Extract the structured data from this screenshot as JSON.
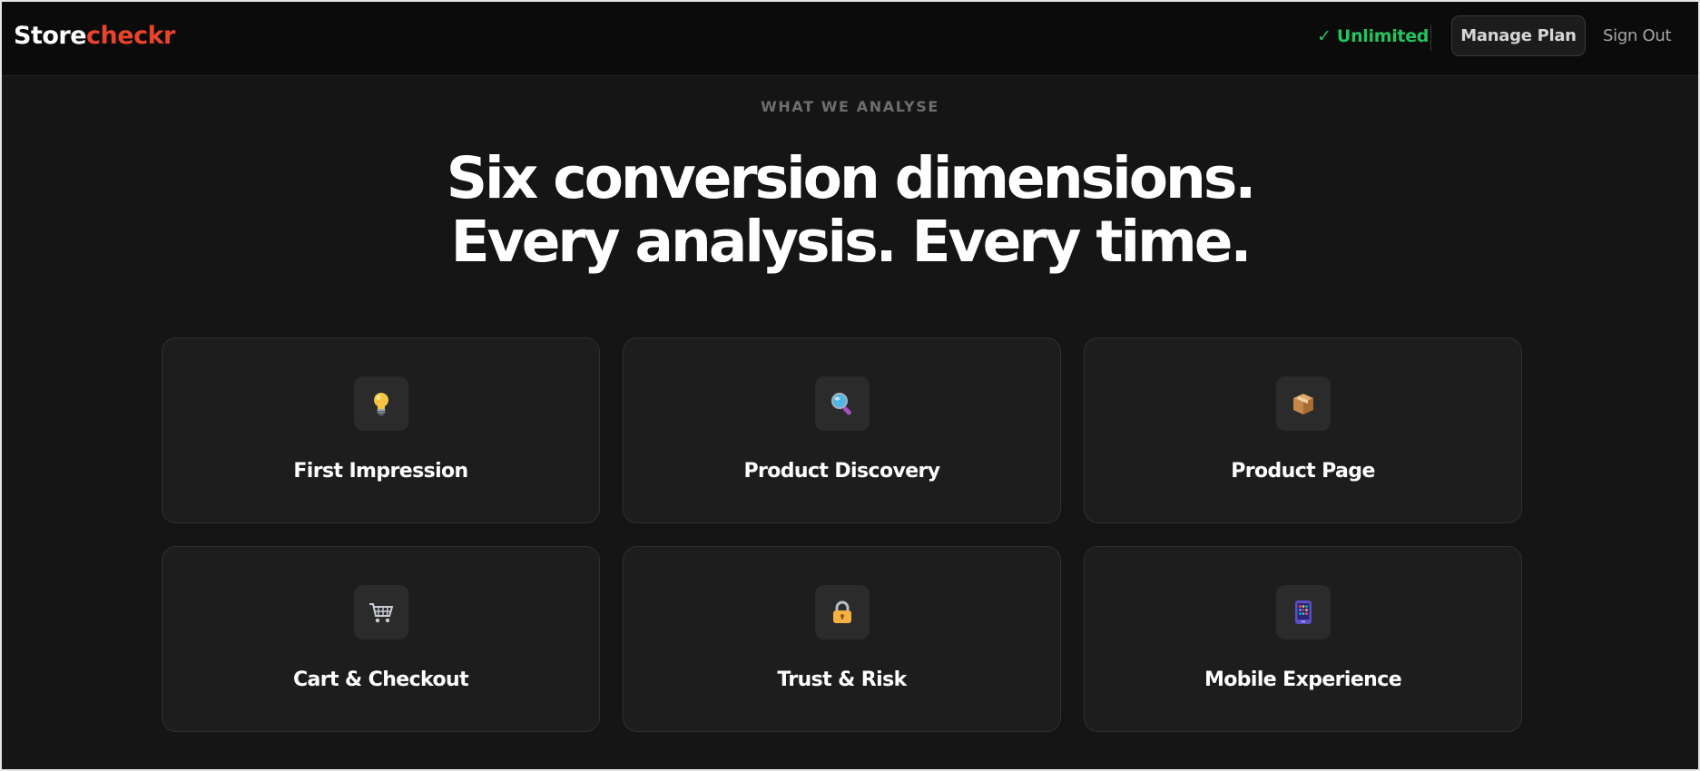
{
  "header": {
    "logo_part1": "Store",
    "logo_part2": "checkr",
    "plan_status": "✓ Unlimited",
    "manage_plan_label": "Manage Plan",
    "sign_out_label": "Sign Out"
  },
  "hero": {
    "eyebrow": "WHAT WE ANALYSE",
    "headline_line1": "Six conversion dimensions.",
    "headline_line2": "Every analysis. Every time."
  },
  "cards": [
    {
      "label": "First Impression",
      "icon": "lightbulb-icon"
    },
    {
      "label": "Product Discovery",
      "icon": "magnifier-icon"
    },
    {
      "label": "Product Page",
      "icon": "package-icon"
    },
    {
      "label": "Cart & Checkout",
      "icon": "shopping-cart-icon"
    },
    {
      "label": "Trust & Risk",
      "icon": "lock-icon"
    },
    {
      "label": "Mobile Experience",
      "icon": "mobile-phone-icon"
    }
  ],
  "colors": {
    "background": "#151515",
    "topbar": "#0b0b0b",
    "card": "#1d1d1d",
    "brand_accent": "#e8442b",
    "plan_status_green": "#22c55e"
  }
}
